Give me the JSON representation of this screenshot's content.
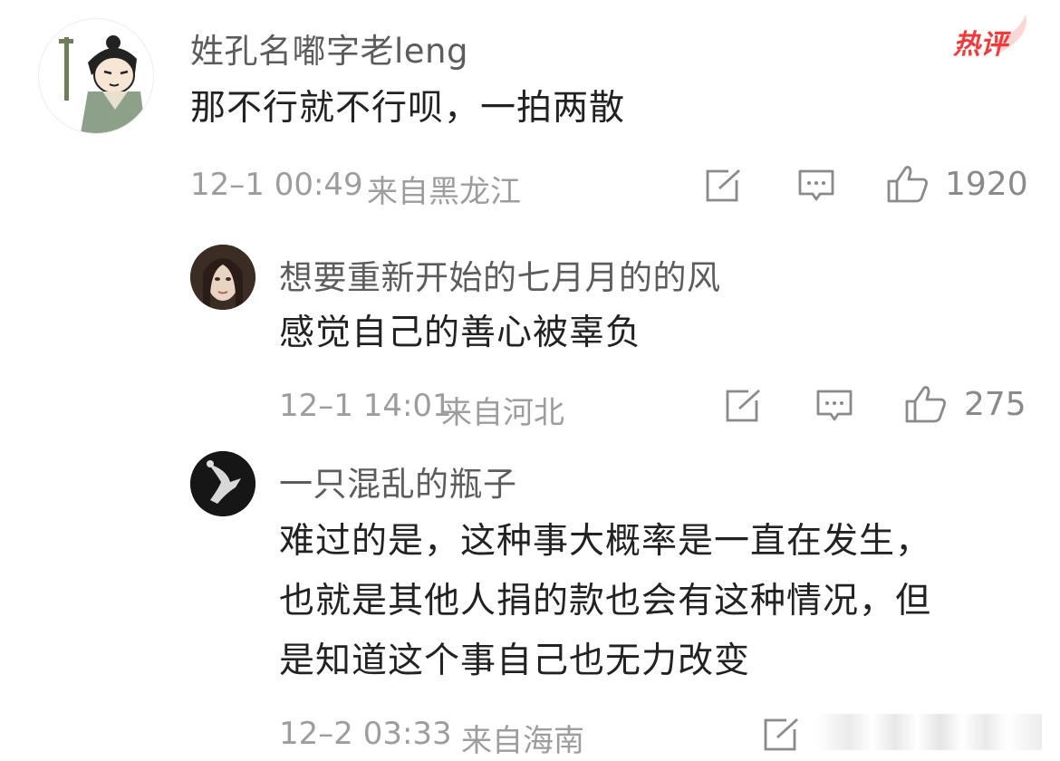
{
  "hot_badge": "热评",
  "comments": [
    {
      "username": "姓孔名嘟字老leng",
      "text_lines": [
        "那不行就不行呗，一拍两散"
      ],
      "time": "12–1 00:49",
      "location": "来自黑龙江",
      "likes": "1920"
    },
    {
      "username": "想要重新开始的七月月的的风",
      "text_lines": [
        "感觉自己的善心被辜负"
      ],
      "time": "12–1 14:01",
      "location": "来自河北",
      "likes": "275"
    },
    {
      "username": "一只混乱的瓶子",
      "text_lines": [
        "难过的是，这种事大概率是一直在发生，",
        "也就是其他人捐的款也会有这种情况，但",
        "是知道这个事自己也无力改变"
      ],
      "time": "12–2 03:33",
      "location": "来自海南",
      "likes": ""
    }
  ],
  "icons": [
    "repost-icon",
    "comment-icon",
    "like-icon"
  ],
  "colors": {
    "hot": "#ef3b3b",
    "meta": "#9d9d9d",
    "name": "#5c5c5c",
    "text": "#222222"
  }
}
